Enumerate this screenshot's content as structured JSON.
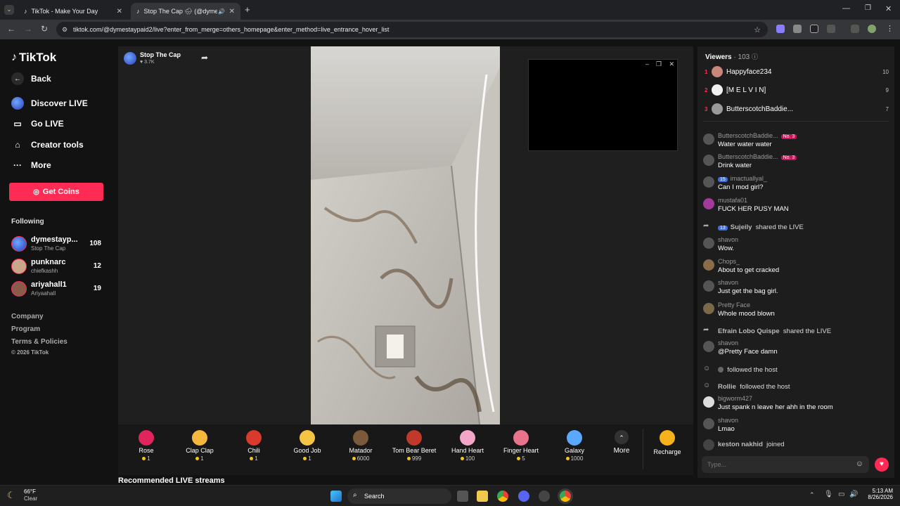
{
  "browser": {
    "tabs": [
      {
        "title": "TikTok - Make Your Day",
        "active": false
      },
      {
        "title": "Stop The Cap 🌧 (@dymes...",
        "active": true
      }
    ],
    "url": "tiktok.com/@dymestaypaid2/live?enter_from_merge=others_homepage&enter_method=live_entrance_hover_list"
  },
  "sidebar": {
    "logo": "TikTok",
    "back": "Back",
    "items": [
      {
        "label": "Discover LIVE",
        "icon": "live-icon"
      },
      {
        "label": "Go LIVE",
        "icon": "camera-icon"
      },
      {
        "label": "Creator tools",
        "icon": "house-icon"
      },
      {
        "label": "More",
        "icon": "ellipsis-icon"
      }
    ],
    "get_coins": "Get Coins",
    "following_title": "Following",
    "following": [
      {
        "name": "dymestayp...",
        "sub": "Stop The Cap",
        "count": "108"
      },
      {
        "name": "punknarc",
        "sub": "chiefkashh",
        "count": "12"
      },
      {
        "name": "ariyahall1",
        "sub": "Ariyaahall",
        "count": "19"
      }
    ],
    "footer": [
      "Company",
      "Program",
      "Terms & Policies",
      "© 2026 TikTok"
    ]
  },
  "stream": {
    "host_name": "Stop The Cap",
    "likes": "3.7K",
    "recommended": "Recommended LIVE streams"
  },
  "gifts": [
    {
      "name": "Rose",
      "price": "1",
      "color": "#e0245e"
    },
    {
      "name": "Clap Clap",
      "price": "1",
      "color": "#f5b83d"
    },
    {
      "name": "Chili",
      "price": "1",
      "color": "#d93a2b"
    },
    {
      "name": "Good Job",
      "price": "1",
      "color": "#f6c445"
    },
    {
      "name": "Matador",
      "price": "6000",
      "color": "#7a5a3a"
    },
    {
      "name": "Tom Bear Beret",
      "price": "999",
      "color": "#c0392b"
    },
    {
      "name": "Hand Heart",
      "price": "100",
      "color": "#f3a6c8"
    },
    {
      "name": "Finger Heart",
      "price": "5",
      "color": "#e8738a"
    },
    {
      "name": "Galaxy",
      "price": "1000",
      "color": "#5aa9ff"
    }
  ],
  "gift_more": "More",
  "recharge": "Recharge",
  "chat": {
    "viewers_label": "Viewers",
    "viewers_count": "· 103",
    "top_viewers": [
      {
        "rank": "1",
        "name": "Happyface234",
        "score": "10"
      },
      {
        "rank": "2",
        "name": "[M E L V I N]",
        "score": "9"
      },
      {
        "rank": "3",
        "name": "ButterscotchBaddie...",
        "score": "7"
      }
    ],
    "messages": [
      {
        "user": "ButterscotchBaddie...",
        "badge": "No. 3",
        "text": "Water water water"
      },
      {
        "user": "ButterscotchBaddie...",
        "badge": "No. 3",
        "text": "Drink water"
      },
      {
        "user": "imactuallyal_",
        "badge": "15",
        "text": "Can I mod girl?"
      },
      {
        "user": "mustafa01",
        "badge": "",
        "text": "FUCK HER PUSY MAN"
      },
      {
        "user": "Sujeily",
        "badge": "13",
        "text": "shared the LIVE",
        "system": true
      },
      {
        "user": "shavon",
        "badge": "",
        "text": "Wow."
      },
      {
        "user": "Chops_",
        "badge": "",
        "text": "About to get cracked"
      },
      {
        "user": "shavon",
        "badge": "",
        "text": "Just get the bag girl."
      },
      {
        "user": "Pretty Face",
        "badge": "",
        "text": "Whole mood blown"
      },
      {
        "user": "Efrain Lobo Quispe",
        "badge": "",
        "text": "shared the LIVE",
        "system": true
      },
      {
        "user": "shavon",
        "badge": "",
        "text": "@Pretty Face  damn"
      },
      {
        "user": "",
        "badge": "",
        "text": "followed the host",
        "system": true
      },
      {
        "user": "Rollie",
        "badge": "",
        "text": "followed the host",
        "system": true
      },
      {
        "user": "bigworm427",
        "badge": "",
        "text": "Just spank n leave her ahh in the room"
      },
      {
        "user": "shavon",
        "badge": "",
        "text": "Lmao"
      },
      {
        "user": "keston nakhid",
        "badge": "",
        "text": "joined",
        "system": true
      }
    ],
    "input_placeholder": "Type..."
  },
  "taskbar": {
    "weather_temp": "66°F",
    "weather_desc": "Clear",
    "search": "Search",
    "time": "5:13 AM",
    "date": "8/26/2026"
  }
}
